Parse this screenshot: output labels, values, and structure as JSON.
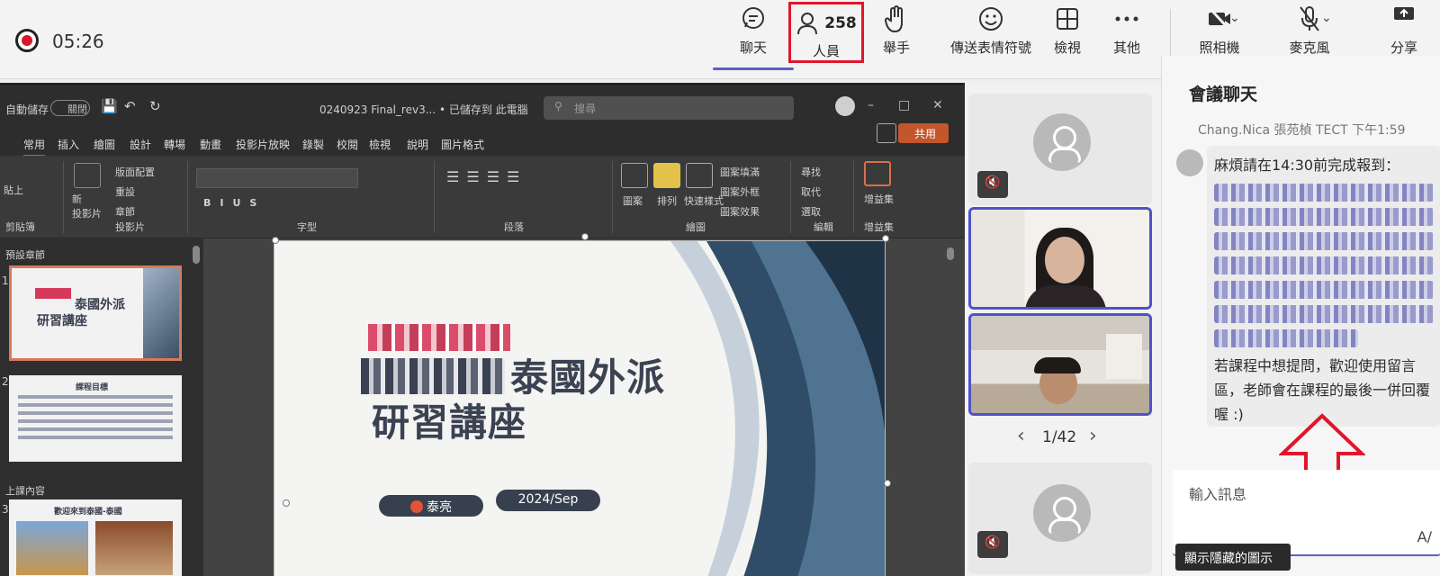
{
  "meeting": {
    "timer": "05:26"
  },
  "toolbar": {
    "chat_label": "聊天",
    "people_label": "人員",
    "people_count": "258",
    "raise_hand_label": "舉手",
    "react_label": "傳送表情符號",
    "view_label": "檢視",
    "more_label": "其他",
    "camera_label": "照相機",
    "mic_label": "麥克風",
    "share_label": "分享"
  },
  "powerpoint": {
    "autosave": "自動儲存",
    "autosave_state": "關閉",
    "filename": "0240923 Final_rev3...  •  已儲存到 此電腦",
    "search_placeholder": "搜尋",
    "share_button": "共用",
    "menu": [
      "常用",
      "插入",
      "繪圖",
      "設計",
      "轉場",
      "動畫",
      "投影片放映",
      "錄製",
      "校閱",
      "檢視",
      "說明",
      "圖片格式"
    ],
    "ribbon": {
      "paste": "貼上",
      "new_slide": "新\n投影片",
      "layout": "版面配置",
      "reset": "重設",
      "section": "章節",
      "shapes": "圖案",
      "arrange": "排列",
      "quick_styles": "快速樣式",
      "shape_fill": "圖案填滿",
      "shape_outline": "圖案外框",
      "shape_effects": "圖案效果",
      "find": "尋找",
      "replace": "取代",
      "select": "選取",
      "addins": "增益集",
      "groups": [
        "剪貼簿",
        "投影片",
        "字型",
        "段落",
        "繪圖",
        "編輯",
        "增益集"
      ]
    },
    "sections": [
      "預設章節",
      "上課內容"
    ],
    "thumb2_title": "課程目標",
    "thumb3_title": "歡迎來到泰國-泰國",
    "slide": {
      "title_line1": "泰國外派",
      "title_line2": "研習講座",
      "author": "泰亮",
      "date": "2024/Sep"
    }
  },
  "gallery": {
    "page_indicator": "1/42"
  },
  "chat": {
    "title": "會議聊天",
    "previous_sender": "Chang.Nica 張苑楨 TECT 下午1:59",
    "message_intro": "麻煩請在14:30前完成報到：",
    "message_body": "若課程中想提問，歡迎使用留言區，老師會在課程的最後一併回覆喔 :)",
    "compose_placeholder": "輸入訊息",
    "tooltip": "顯示隱藏的圖示"
  },
  "colors": {
    "accent": "#5b5fc7",
    "highlight_red": "#e0162b",
    "ppt_share": "#c4562c"
  }
}
